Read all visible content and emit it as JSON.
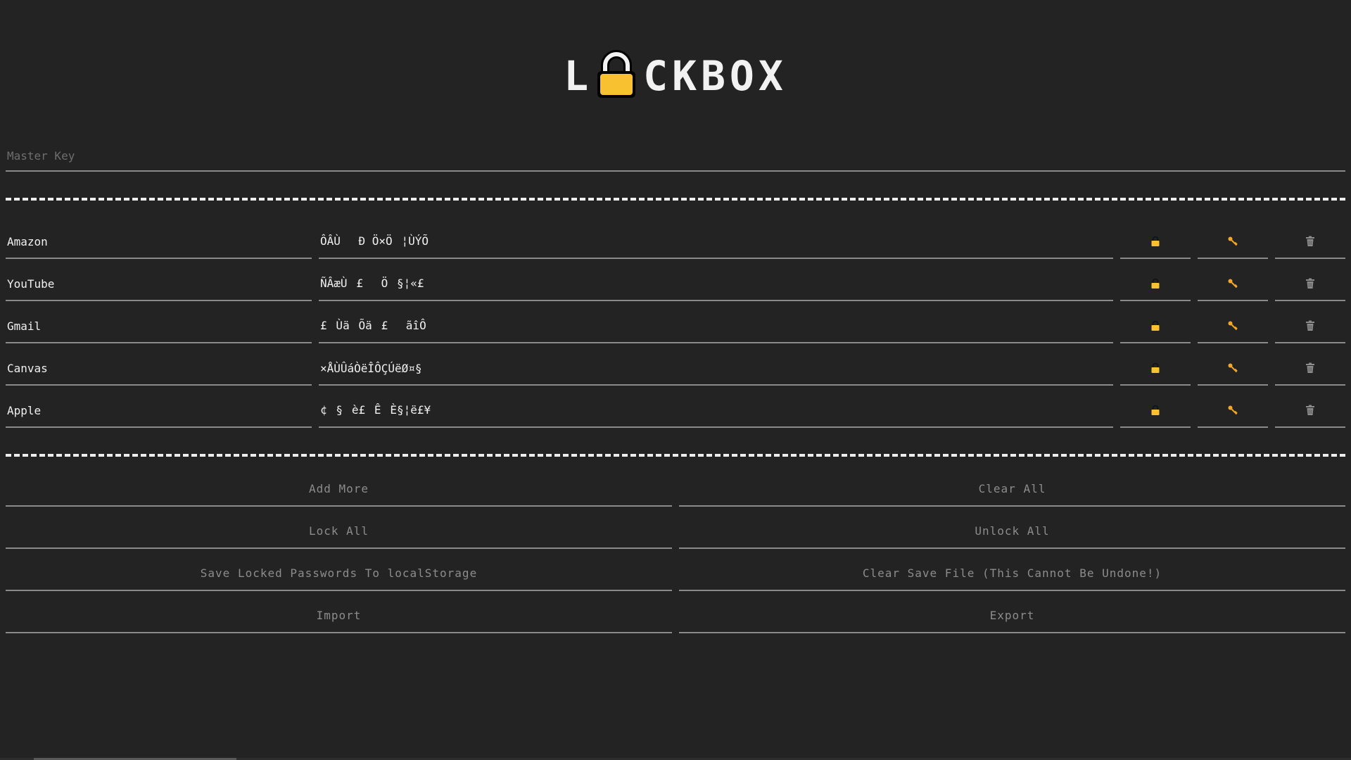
{
  "logo": {
    "letter_left": "L",
    "letters_right": "CKBOX",
    "lock_color": "#f7c12f"
  },
  "master_key": {
    "placeholder": "Master Key",
    "value": ""
  },
  "entries": [
    {
      "name": "Amazon",
      "password": "ÔÂÙÐ Ö×Ö¦ÙÝÕ"
    },
    {
      "name": "YouTube",
      "password": "ÑÂæÙ£Ö§¦«£"
    },
    {
      "name": "Gmail",
      "password": "£ÙäÕä£ãîÔ"
    },
    {
      "name": "Canvas",
      "password": "×ÅÙÛáÒëÎÔÇÚëØ¤§"
    },
    {
      "name": "Apple",
      "password": "¢§è£ÊÈ§¦ë£¥"
    }
  ],
  "entry_icons": {
    "lock": "lock-icon",
    "key": "key-icon",
    "delete": "trash-icon",
    "accent": "#f2a72a",
    "trash_color": "#8c8c8c"
  },
  "buttons": {
    "add_more": "Add More",
    "clear_all": "Clear All",
    "lock_all": "Lock All",
    "unlock_all": "Unlock All",
    "save_local": "Save Locked Passwords To localStorage",
    "clear_save": "Clear Save File (This Cannot Be Undone!)",
    "import": "Import",
    "export": "Export"
  }
}
